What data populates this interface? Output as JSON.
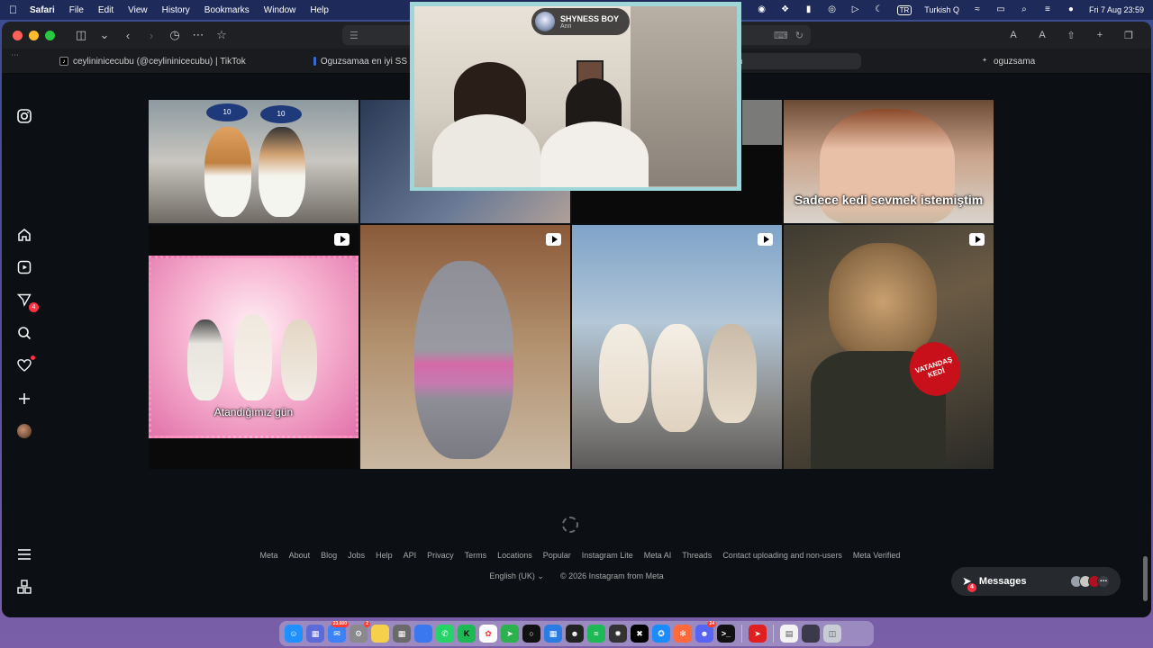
{
  "menubar": {
    "app_name": "Safari",
    "menus": [
      "File",
      "Edit",
      "View",
      "History",
      "Bookmarks",
      "Window",
      "Help"
    ],
    "input_source": "Turkish Q",
    "input_badge": "TR",
    "datetime": "Fri 7 Aug  23:59"
  },
  "browser": {
    "text_size_small": "A",
    "text_size_large": "A",
    "tabs": [
      {
        "label": "ceylininicecubu (@ceylininicecubu) | TikTok"
      },
      {
        "label": "Oguzsamaa en iyi SS"
      },
      {
        "label": "m"
      },
      {
        "label": "oguzsama"
      }
    ]
  },
  "overlay": {
    "name": "SHYNESS BOY",
    "subtitle": "Anri"
  },
  "grid": {
    "captions": {
      "tile4": "Sadece kedi sevmek istemiştim",
      "tile5": "Atandığımız gün",
      "mic_label": "VATANDAŞ KEDİ",
      "cat_hat_1": "10",
      "cat_hat_2": "10"
    }
  },
  "sidebar": {
    "messages_count": "4"
  },
  "footer": {
    "links": [
      "Meta",
      "About",
      "Blog",
      "Jobs",
      "Help",
      "API",
      "Privacy",
      "Terms",
      "Locations",
      "Popular",
      "Instagram Lite",
      "Meta AI",
      "Threads",
      "Contact uploading and non-users",
      "Meta Verified"
    ],
    "language": "English (UK)",
    "copyright": "© 2026 Instagram from Meta"
  },
  "messages_bar": {
    "label": "Messages",
    "count": "4"
  },
  "dock": {
    "mail_badge": "23,600",
    "settings_badge": "2",
    "discord_badge": "24"
  }
}
